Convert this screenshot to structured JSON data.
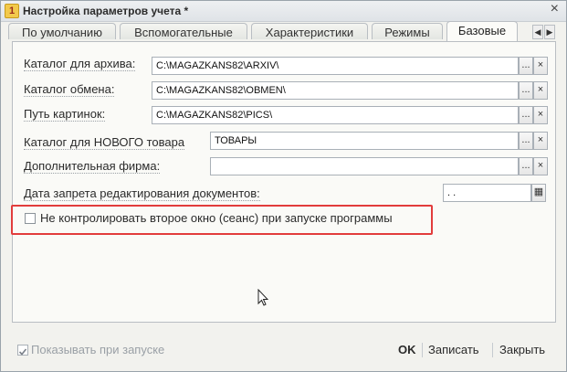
{
  "window": {
    "title": "Настройка параметров учета *",
    "close_glyph": "×"
  },
  "tabs": [
    {
      "label": "По умолчанию",
      "active": false
    },
    {
      "label": "Вспомогательные",
      "active": false
    },
    {
      "label": "Характеристики",
      "active": false
    },
    {
      "label": "Режимы",
      "active": false
    },
    {
      "label": "Базовые",
      "active": true
    }
  ],
  "tab_scroll": {
    "left": "◀",
    "right": "▶"
  },
  "form": {
    "archive_label": "Каталог для архива:",
    "archive_value": "C:\\MAGAZKANS82\\ARXIV\\",
    "exchange_label": "Каталог обмена:",
    "exchange_value": "C:\\MAGAZKANS82\\OBMEN\\",
    "pics_label": "Путь картинок:",
    "pics_value": "C:\\MAGAZKANS82\\PICS\\",
    "new_goods_label": "Каталог для НОВОГО товара",
    "new_goods_value": "ТОВАРЫ",
    "extra_firm_label": "Дополнительная фирма:",
    "extra_firm_value": "",
    "edit_lock_label": "Дата запрета редактирования документов:",
    "edit_lock_value": " .  .",
    "select_glyph": "...",
    "clear_glyph": "×",
    "calendar_glyph": "▦",
    "session_checkbox_label": "Не контролировать второе окно (сеанс) при запуске программы",
    "session_checkbox_checked": false
  },
  "footer": {
    "show_on_start_label": "Показывать при запуске",
    "show_on_start_checked": true,
    "ok_label": "OK",
    "save_label": "Записать",
    "close_label": "Закрыть"
  },
  "colors": {
    "highlight_border": "#e23c3c",
    "window_bg": "#f2f2ee"
  }
}
